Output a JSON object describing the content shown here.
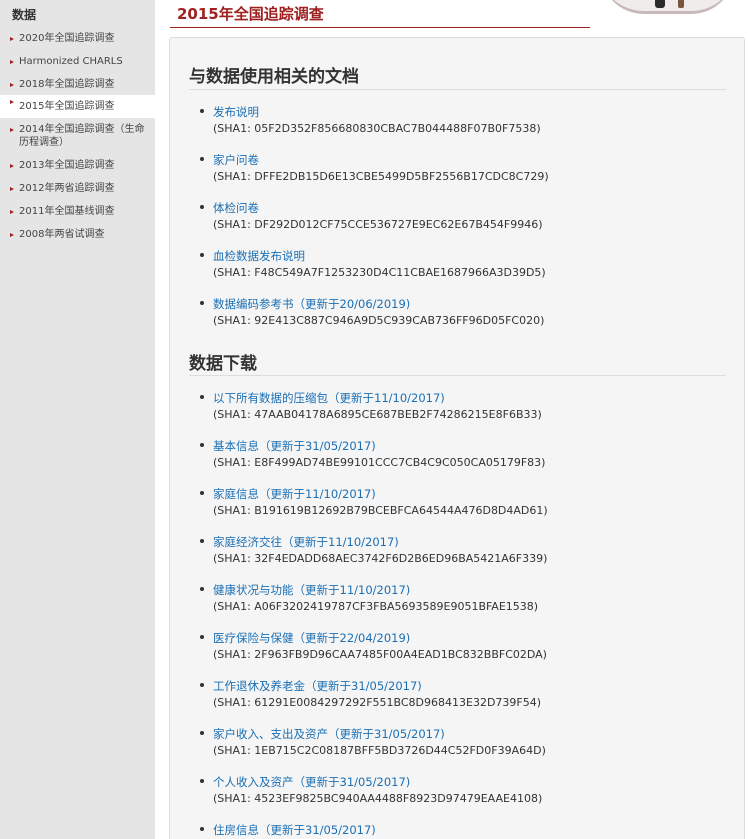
{
  "sidebar": {
    "title": "数据",
    "items": [
      {
        "label": "2020年全国追踪调查",
        "active": false
      },
      {
        "label": "Harmonized CHARLS",
        "active": false
      },
      {
        "label": "2018年全国追踪调查",
        "active": false
      },
      {
        "label": "2015年全国追踪调查",
        "active": true
      },
      {
        "label": "2014年全国追踪调查（生命历程调查）",
        "active": false
      },
      {
        "label": "2013年全国追踪调查",
        "active": false
      },
      {
        "label": "2012年两省追踪调查",
        "active": false
      },
      {
        "label": "2011年全国基线调查",
        "active": false
      },
      {
        "label": "2008年两省试调查",
        "active": false
      }
    ]
  },
  "page": {
    "title": "2015年全国追踪调查"
  },
  "docs": {
    "heading": "与数据使用相关的文档",
    "items": [
      {
        "link": "发布说明",
        "hash": "(SHA1: 05F2D352F856680830CBAC7B044488F07B0F7538)"
      },
      {
        "link": "家户问卷",
        "hash": "(SHA1: DFFE2DB15D6E13CBE5499D5BF2556B17CDC8C729)"
      },
      {
        "link": "体检问卷",
        "hash": "(SHA1: DF292D012CF75CCE536727E9EC62E67B454F9946)"
      },
      {
        "link": "血检数据发布说明",
        "hash": "(SHA1: F48C549A7F1253230D4C11CBAE1687966A3D39D5)"
      },
      {
        "link": "数据编码参考书（更新于20/06/2019)",
        "hash": "(SHA1: 92E413C887C946A9D5C939CAB736FF96D05FC020)"
      }
    ]
  },
  "downloads": {
    "heading": "数据下载",
    "items": [
      {
        "link": "以下所有数据的压缩包（更新于11/10/2017)",
        "hash": "(SHA1: 47AAB04178A6895CE687BEB2F74286215E8F6B33)"
      },
      {
        "link": "基本信息（更新于31/05/2017)",
        "hash": "(SHA1: E8F499AD74BE99101CCC7CB4C9C050CA05179F83)"
      },
      {
        "link": "家庭信息（更新于11/10/2017)",
        "hash": "(SHA1: B191619B12692B79BCEBFCA64544A476D8D4AD61)"
      },
      {
        "link": "家庭经济交往（更新于11/10/2017)",
        "hash": "(SHA1: 32F4EDADD68AEC3742F6D2B6ED96BA5421A6F339)"
      },
      {
        "link": "健康状况与功能（更新于11/10/2017)",
        "hash": "(SHA1: A06F3202419787CF3FBA5693589E9051BFAE1538)"
      },
      {
        "link": "医疗保险与保健（更新于22/04/2019)",
        "hash": "(SHA1: 2F963FB9D96CAA7485F00A4EAD1BC832BBFC02DA)"
      },
      {
        "link": "工作退休及养老金（更新于31/05/2017)",
        "hash": "(SHA1: 61291E0084297292F551BC8D968413E32D739F54)"
      },
      {
        "link": "家户收入、支出及资产（更新于31/05/2017)",
        "hash": "(SHA1: 1EB715C2C08187BFF5BD3726D44C52FD0F39A64D)"
      },
      {
        "link": "个人收入及资产（更新于31/05/2017)",
        "hash": "(SHA1: 4523EF9825BC940AA4488F8923D97479EAAE4108)"
      },
      {
        "link": "住房信息（更新于31/05/2017)",
        "hash": ""
      }
    ]
  }
}
